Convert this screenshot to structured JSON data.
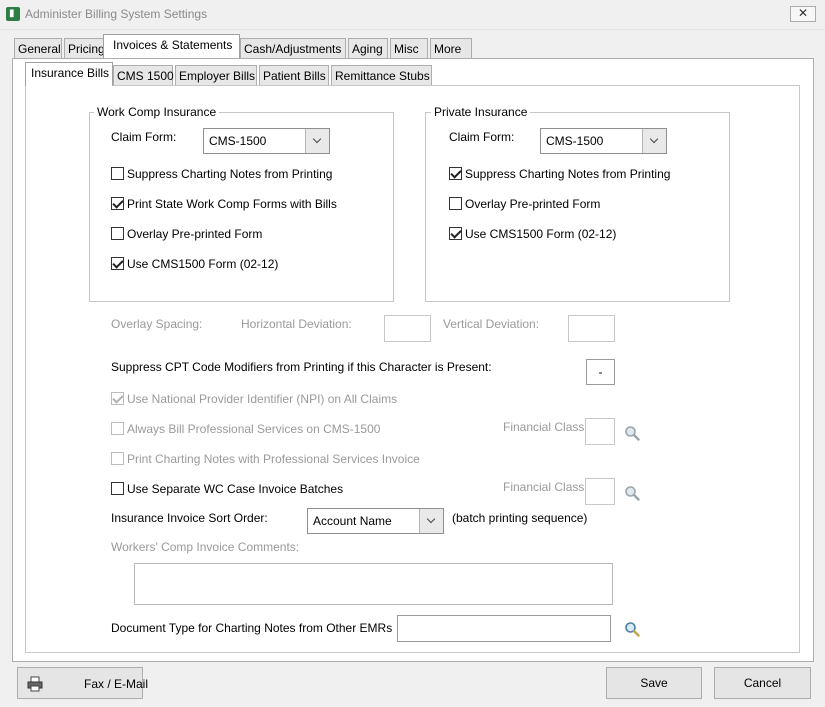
{
  "window": {
    "title": "Administer Billing System Settings",
    "close_glyph": "✕"
  },
  "tabs": [
    "General",
    "Pricing",
    "Invoices & Statements",
    "Cash/Adjustments",
    "Aging",
    "Misc",
    "More"
  ],
  "subtabs": [
    "Insurance Bills",
    "CMS 1500",
    "Employer Bills",
    "Patient Bills",
    "Remittance Stubs"
  ],
  "work_comp": {
    "legend": "Work Comp Insurance",
    "claim_form_label": "Claim Form:",
    "claim_form_value": "CMS-1500",
    "suppress_label": "Suppress Charting Notes from Printing",
    "print_state_label": "Print State Work Comp Forms with Bills",
    "overlay_label": "Overlay Pre-printed Form",
    "use_cms_label": "Use CMS1500 Form (02-12)"
  },
  "private": {
    "legend": "Private Insurance",
    "claim_form_label": "Claim Form:",
    "claim_form_value": "CMS-1500",
    "suppress_label": "Suppress Charting Notes from Printing",
    "overlay_label": "Overlay Pre-printed Form",
    "use_cms_label": "Use CMS1500 Form (02-12)"
  },
  "overlay_spacing": {
    "label": "Overlay Spacing:",
    "horizontal_label": "Horizontal Deviation:",
    "vertical_label": "Vertical Deviation:"
  },
  "suppress_cpt": {
    "label": "Suppress CPT Code Modifiers from Printing if this Character is Present:",
    "value": "-"
  },
  "npi_label": "Use National Provider Identifier (NPI) on All Claims",
  "always_bill_label": "Always Bill Professional Services on CMS-1500",
  "financial_class_label": "Financial Class:",
  "print_charting_label": "Print Charting Notes with Professional Services Invoice",
  "separate_wc_label": "Use Separate WC Case Invoice Batches",
  "sort_order": {
    "label": "Insurance Invoice Sort Order:",
    "value": "Account Name",
    "suffix": "(batch printing sequence)"
  },
  "wc_comments_label": "Workers' Comp Invoice Comments:",
  "doc_type_label": "Document Type for Charting Notes from Other EMRs",
  "buttons": {
    "fax": "Fax / E-Mail",
    "save": "Save",
    "cancel": "Cancel"
  }
}
